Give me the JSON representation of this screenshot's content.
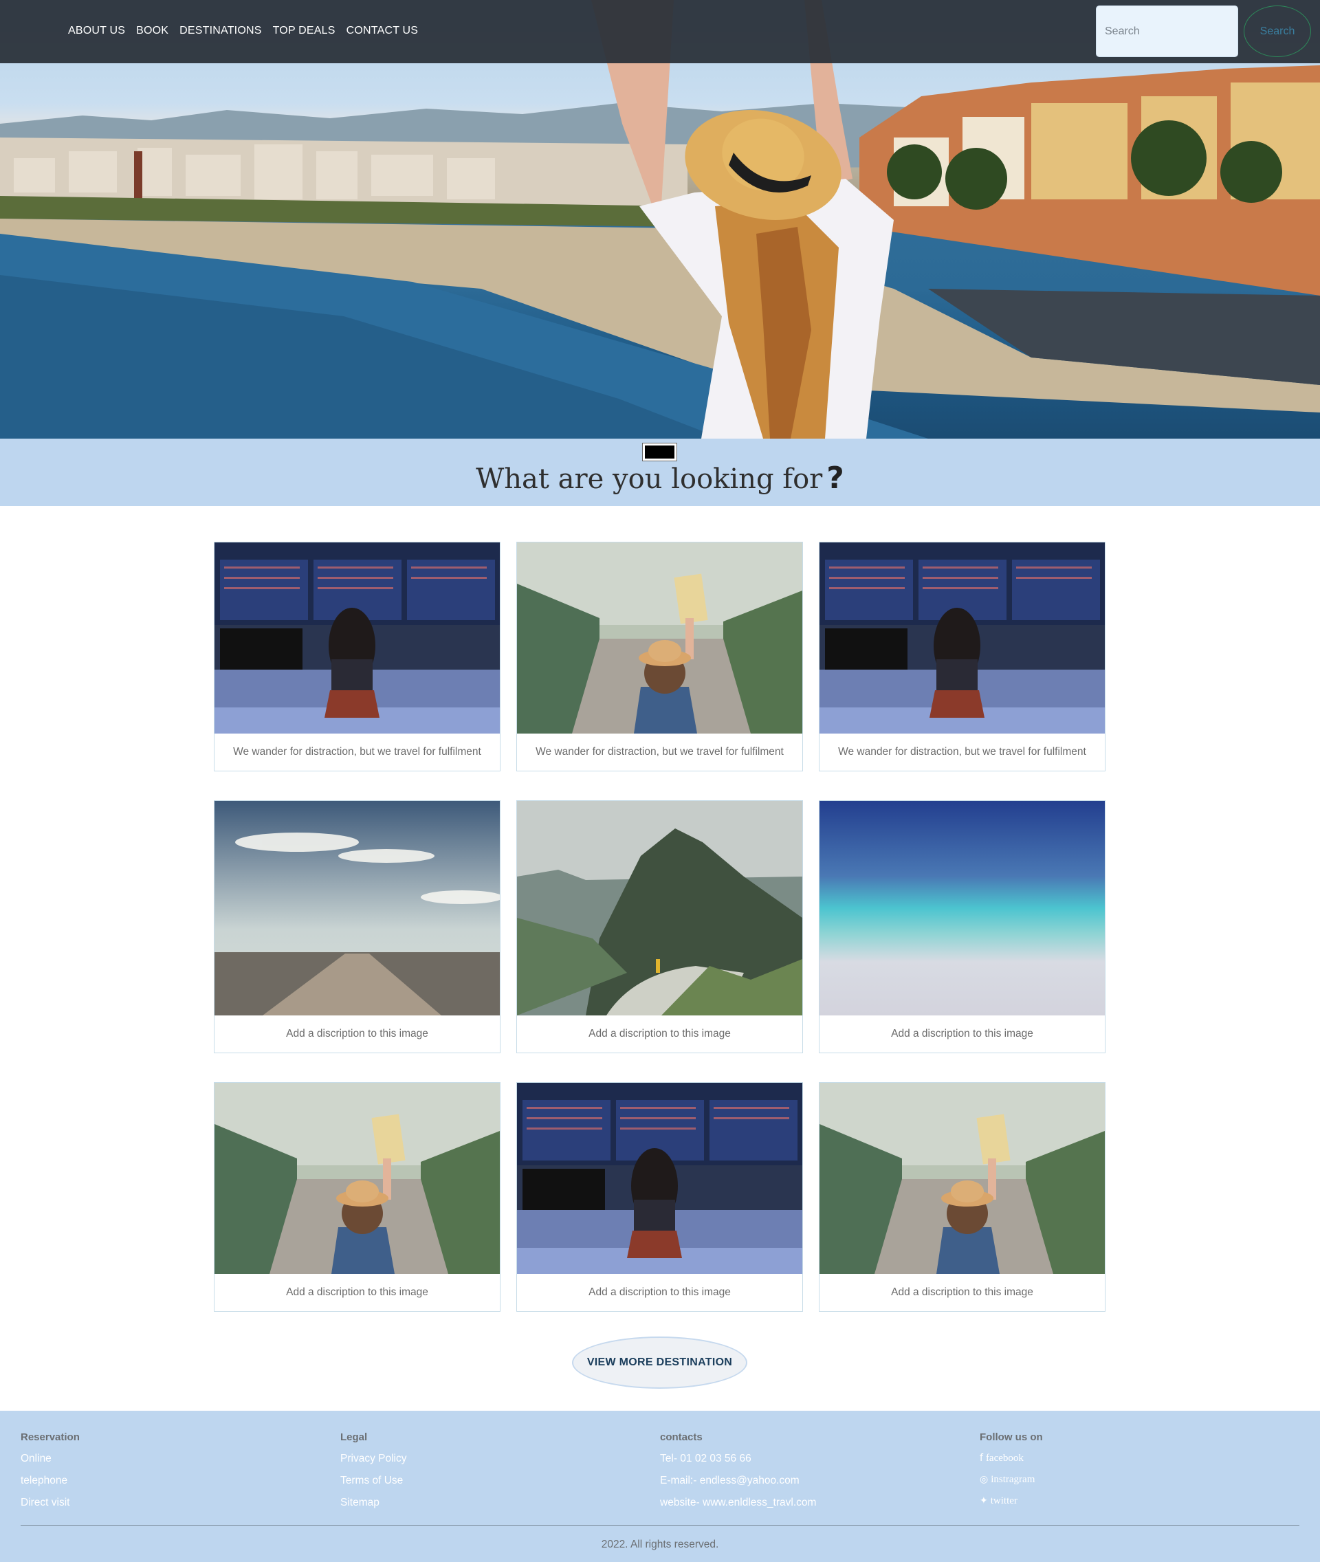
{
  "nav": {
    "links": [
      "ABOUT US",
      "BOOK",
      "DESTINATIONS",
      "TOP DEALS",
      "CONTACT US"
    ],
    "search_placeholder": "Search",
    "search_button": "Search"
  },
  "headline": {
    "text": "What are you looking for",
    "icon": "question-mark-icon"
  },
  "cards": [
    {
      "caption": "We wander for distraction, but we travel for fulfilment",
      "image": "airport-departure-board"
    },
    {
      "caption": "We wander for distraction, but we travel for fulfilment",
      "image": "traveler-with-map-on-bridge"
    },
    {
      "caption": "We wander for distraction, but we travel for fulfilment",
      "image": "airport-departure-board"
    },
    {
      "caption": "Add a discription to this image",
      "image": "open-road-sky"
    },
    {
      "caption": "Add a discription to this image",
      "image": "mountain-island-view"
    },
    {
      "caption": "Add a discription to this image",
      "image": "blurred-beach"
    },
    {
      "caption": "Add a discription to this image",
      "image": "traveler-with-map-on-bridge"
    },
    {
      "caption": "Add a discription to this image",
      "image": "airport-departure-board"
    },
    {
      "caption": "Add a discription to this image",
      "image": "traveler-with-map-on-bridge"
    }
  ],
  "view_more": "VIEW MORE DESTINATION",
  "footer": {
    "reservation": {
      "heading": "Reservation",
      "items": [
        "Online",
        "telephone",
        "Direct visit"
      ]
    },
    "legal": {
      "heading": "Legal",
      "items": [
        "Privacy Policy",
        "Terms of Use",
        "Sitemap"
      ]
    },
    "contacts": {
      "heading": "contacts",
      "items": [
        "Tel- 01 02 03 56 66",
        "E-mail:- endless@yahoo.com",
        "website- www.enldless_travl.com"
      ]
    },
    "follow": {
      "heading": "Follow us on",
      "items": [
        {
          "icon": "facebook-icon",
          "label": "facebook"
        },
        {
          "icon": "instagram-icon",
          "label": "instragram"
        },
        {
          "icon": "twitter-icon",
          "label": "twitter"
        }
      ]
    },
    "copyright": "2022. All rights reserved."
  },
  "colors": {
    "navbar": "#2b313a",
    "band": "#bed6ef",
    "accent": "#1b3e5c"
  }
}
